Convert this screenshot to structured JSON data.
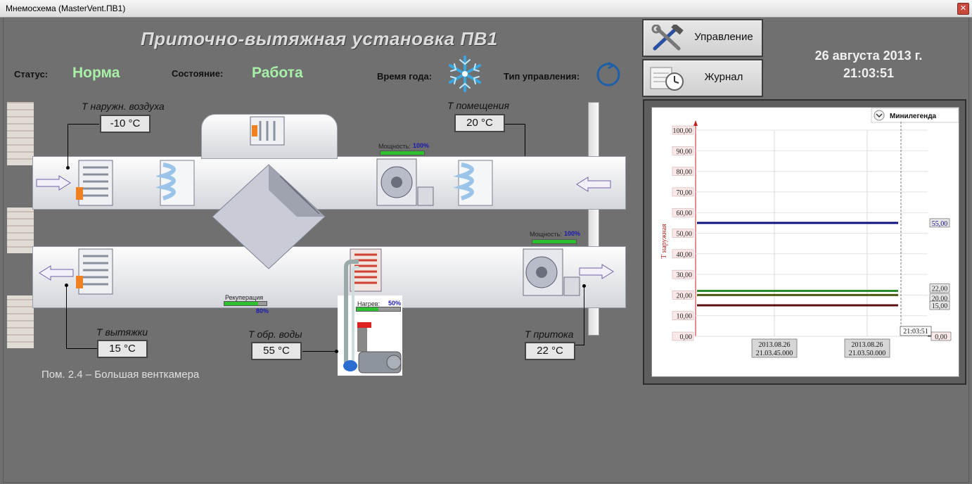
{
  "window": {
    "title": "Мнемосхема (MasterVent.ПВ1)"
  },
  "header": {
    "title": "Приточно-вытяжная установка ПВ1",
    "status_label": "Статус:",
    "status_value": "Норма",
    "state_label": "Состояние:",
    "state_value": "Работа",
    "season_label": "Время года:",
    "control_type_label": "Тип управления:"
  },
  "buttons": {
    "control": "Управление",
    "journal": "Журнал"
  },
  "datetime": {
    "date": "26 августа 2013 г.",
    "time": "21:03:51"
  },
  "sensors": {
    "outdoor": {
      "label": "Т наружн. воздуха",
      "value": "-10 °C"
    },
    "room": {
      "label": "Т помещения",
      "value": "20 °C"
    },
    "exhaust": {
      "label": "Т вытяжки",
      "value": "15 °C"
    },
    "return_water": {
      "label": "Т обр. воды",
      "value": "55 °C"
    },
    "supply": {
      "label": "Т притока",
      "value": "22 °C"
    }
  },
  "indicators": {
    "fan_top": {
      "label": "Мощность:",
      "value": "100%",
      "level": 1.0
    },
    "fan_bottom": {
      "label": "Мощность:",
      "value": "100%",
      "level": 1.0
    },
    "recuperation": {
      "label": "Рекуперация",
      "value": "80%",
      "level": 0.8
    },
    "heating": {
      "label": "Нагрев:",
      "value": "50%",
      "level": 0.5
    }
  },
  "room_note": "Пом. 2.4 – Большая венткамера",
  "colors": {
    "green_text": "#a8f0a8",
    "bar": "#2fc02f"
  },
  "chart_data": {
    "type": "line",
    "legend_button": "Минилегенда",
    "ylabel": "Т наружная",
    "ylim": [
      0,
      100
    ],
    "y_ticks": [
      "0,00",
      "10,00",
      "20,00",
      "30,00",
      "40,00",
      "50,00",
      "60,00",
      "70,00",
      "80,00",
      "90,00",
      "100,00"
    ],
    "x_ticks": [
      {
        "date": "2013.08.26",
        "time": "21.03.45.000"
      },
      {
        "date": "2013.08.26",
        "time": "21.03.50.000"
      }
    ],
    "cursor_time": "21:03:51",
    "series": [
      {
        "label": "55,00",
        "value": 55,
        "color": "#101080"
      },
      {
        "label": "22,00",
        "value": 22,
        "color": "#2c8a2c"
      },
      {
        "label": "20,00",
        "value": 20,
        "color": "#4a5a10"
      },
      {
        "label": "15,00",
        "value": 15,
        "color": "#5a1010"
      },
      {
        "label": "0,00",
        "value": 0,
        "color": "#c82020"
      }
    ]
  }
}
